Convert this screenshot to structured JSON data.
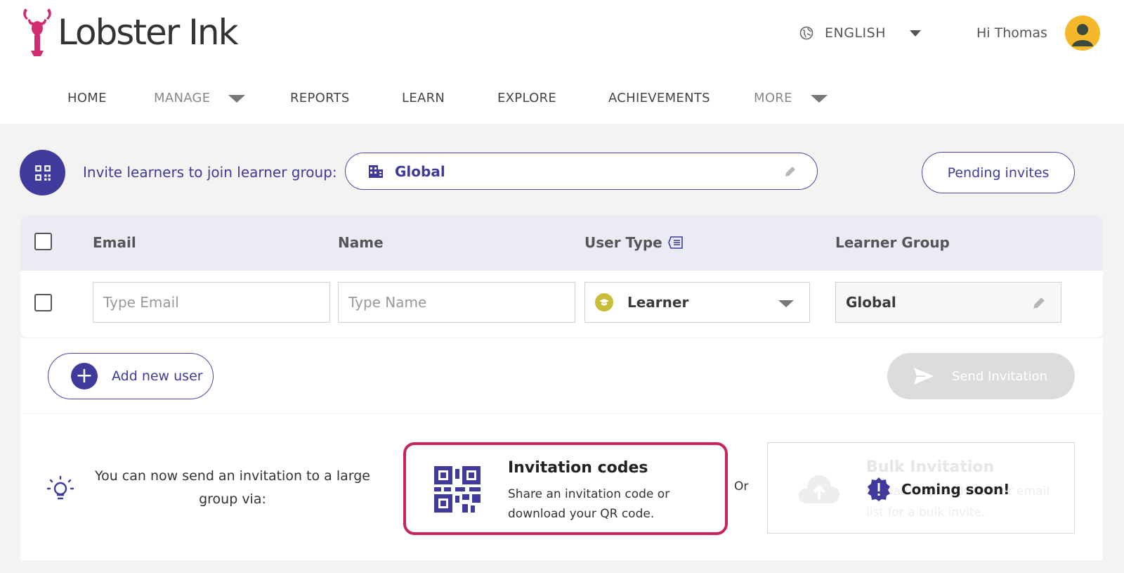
{
  "header": {
    "brand": "Lobster Ink",
    "language": "ENGLISH",
    "greeting": "Hi Thomas"
  },
  "nav": {
    "items": [
      {
        "label": "HOME"
      },
      {
        "label": "MANAGE"
      },
      {
        "label": "REPORTS"
      },
      {
        "label": "LEARN"
      },
      {
        "label": "EXPLORE"
      },
      {
        "label": "ACHIEVEMENTS"
      },
      {
        "label": "MORE"
      }
    ]
  },
  "invite": {
    "label": "Invite learners to join learner group:",
    "group": "Global",
    "pending_button": "Pending invites"
  },
  "table": {
    "headers": {
      "email": "Email",
      "name": "Name",
      "user_type": "User Type",
      "learner_group": "Learner Group"
    },
    "row": {
      "email_placeholder": "Type Email",
      "name_placeholder": "Type Name",
      "user_type": "Learner",
      "learner_group": "Global"
    }
  },
  "actions": {
    "add_user": "Add new user",
    "send_invitation": "Send Invitation"
  },
  "bulk": {
    "hint": "You can now send an invitation to a large group via:",
    "invitation_codes": {
      "title": "Invitation codes",
      "description": "Share an invitation code or download your QR code."
    },
    "or": "Or",
    "bulk_invitation": {
      "title": "Bulk Invitation",
      "description": "Upload a spreadsheet or email list for a bulk invite.",
      "coming_soon": "Coming soon!"
    }
  },
  "colors": {
    "primary": "#3f3a9c",
    "brand_pink": "#d22b6f",
    "highlight": "#c6235f",
    "learner_badge": "#c9bd3a",
    "avatar": "#f5b82a"
  }
}
